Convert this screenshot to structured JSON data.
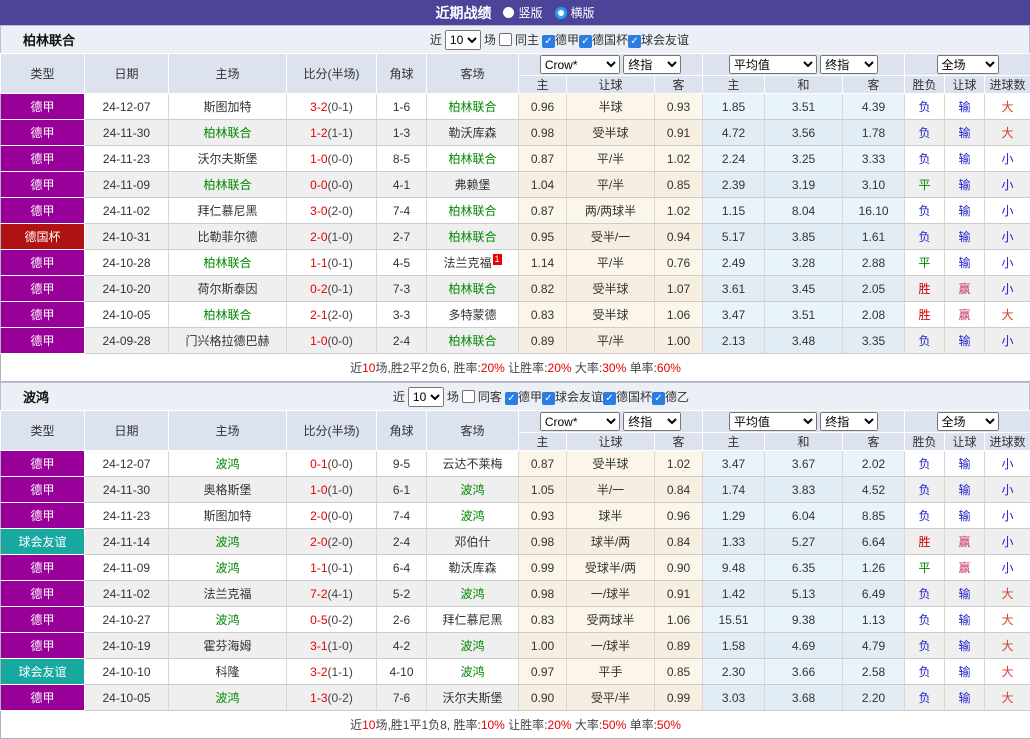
{
  "titlebar": {
    "title": "近期战绩",
    "vertical_label": "竖版",
    "horizontal_label": "横版"
  },
  "table_header": {
    "cols": [
      "类型",
      "日期",
      "主场",
      "比分(半场)",
      "角球",
      "客场"
    ],
    "sub_handicap": [
      "主",
      "让球",
      "客"
    ],
    "sub_europe": [
      "主",
      "和",
      "客"
    ],
    "sub_result": [
      "胜负",
      "让球",
      "进球数"
    ]
  },
  "dropdowns": {
    "count": "10",
    "bookmaker": "Crow*",
    "final1": "终指",
    "average": "平均值",
    "final2": "终指",
    "fullmatch": "全场"
  },
  "type_colors": {
    "德甲": "#990099",
    "德国杯": "#b01111",
    "球会友谊": "#17a8a0"
  },
  "result_colors": {
    "胜": "#d10000",
    "平": "#008800",
    "负": "#2222cc",
    "赢": "#cc3366",
    "输": "#2222cc",
    "大": "#d43f2f",
    "小": "#2222cc"
  },
  "sections": [
    {
      "team": "柏林联合",
      "filters": {
        "recent": "近",
        "count": "10",
        "games": "场",
        "same": "同主",
        "leagues": [
          {
            "label": "德甲",
            "checked": true
          },
          {
            "label": "德国杯",
            "checked": true
          },
          {
            "label": "球会友谊",
            "checked": true
          }
        ]
      },
      "rows": [
        {
          "type": "德甲",
          "date": "24-12-07",
          "home": "斯图加特",
          "score": "3-2",
          "half": "(0-1)",
          "corner": "1-6",
          "away": "柏林联合",
          "h1": "0.96",
          "hc": "半球",
          "h2": "0.93",
          "e1": "1.85",
          "e2": "3.51",
          "e3": "4.39",
          "r": [
            "负",
            "输",
            "大"
          ]
        },
        {
          "type": "德甲",
          "date": "24-11-30",
          "home": "柏林联合",
          "score": "1-2",
          "half": "(1-1)",
          "corner": "1-3",
          "away": "勒沃库森",
          "h1": "0.98",
          "hc": "受半球",
          "h2": "0.91",
          "e1": "4.72",
          "e2": "3.56",
          "e3": "1.78",
          "r": [
            "负",
            "输",
            "大"
          ]
        },
        {
          "type": "德甲",
          "date": "24-11-23",
          "home": "沃尔夫斯堡",
          "score": "1-0",
          "half": "(0-0)",
          "corner": "8-5",
          "away": "柏林联合",
          "h1": "0.87",
          "hc": "平/半",
          "h2": "1.02",
          "e1": "2.24",
          "e2": "3.25",
          "e3": "3.33",
          "r": [
            "负",
            "输",
            "小"
          ]
        },
        {
          "type": "德甲",
          "date": "24-11-09",
          "home": "柏林联合",
          "score": "0-0",
          "half": "(0-0)",
          "corner": "4-1",
          "away": "弗赖堡",
          "h1": "1.04",
          "hc": "平/半",
          "h2": "0.85",
          "e1": "2.39",
          "e2": "3.19",
          "e3": "3.10",
          "r": [
            "平",
            "输",
            "小"
          ]
        },
        {
          "type": "德甲",
          "date": "24-11-02",
          "home": "拜仁慕尼黑",
          "score": "3-0",
          "half": "(2-0)",
          "corner": "7-4",
          "away": "柏林联合",
          "h1": "0.87",
          "hc": "两/两球半",
          "h2": "1.02",
          "e1": "1.15",
          "e2": "8.04",
          "e3": "16.10",
          "r": [
            "负",
            "输",
            "小"
          ]
        },
        {
          "type": "德国杯",
          "date": "24-10-31",
          "home": "比勒菲尔德",
          "score": "2-0",
          "half": "(1-0)",
          "corner": "2-7",
          "away": "柏林联合",
          "h1": "0.95",
          "hc": "受半/一",
          "h2": "0.94",
          "e1": "5.17",
          "e2": "3.85",
          "e3": "1.61",
          "r": [
            "负",
            "输",
            "小"
          ]
        },
        {
          "type": "德甲",
          "date": "24-10-28",
          "home": "柏林联合",
          "score": "1-1",
          "half": "(0-1)",
          "corner": "4-5",
          "away": "法兰克福",
          "sup": "1",
          "h1": "1.14",
          "hc": "平/半",
          "h2": "0.76",
          "e1": "2.49",
          "e2": "3.28",
          "e3": "2.88",
          "r": [
            "平",
            "输",
            "小"
          ]
        },
        {
          "type": "德甲",
          "date": "24-10-20",
          "home": "荷尔斯泰因",
          "score": "0-2",
          "half": "(0-1)",
          "corner": "7-3",
          "away": "柏林联合",
          "h1": "0.82",
          "hc": "受半球",
          "h2": "1.07",
          "e1": "3.61",
          "e2": "3.45",
          "e3": "2.05",
          "r": [
            "胜",
            "赢",
            "小"
          ]
        },
        {
          "type": "德甲",
          "date": "24-10-05",
          "home": "柏林联合",
          "score": "2-1",
          "half": "(2-0)",
          "corner": "3-3",
          "away": "多特蒙德",
          "h1": "0.83",
          "hc": "受半球",
          "h2": "1.06",
          "e1": "3.47",
          "e2": "3.51",
          "e3": "2.08",
          "r": [
            "胜",
            "赢",
            "大"
          ]
        },
        {
          "type": "德甲",
          "date": "24-09-28",
          "home": "门兴格拉德巴赫",
          "score": "1-0",
          "half": "(0-0)",
          "corner": "2-4",
          "away": "柏林联合",
          "h1": "0.89",
          "hc": "平/半",
          "h2": "1.00",
          "e1": "2.13",
          "e2": "3.48",
          "e3": "3.35",
          "r": [
            "负",
            "输",
            "小"
          ]
        }
      ],
      "summary": [
        {
          "t": "近"
        },
        {
          "t": "10",
          "red": true
        },
        {
          "t": "场,胜2平2负6, 胜率:"
        },
        {
          "t": "20%",
          "red": true
        },
        {
          "t": " 让胜率:"
        },
        {
          "t": "20%",
          "red": true
        },
        {
          "t": " 大率:"
        },
        {
          "t": "30%",
          "red": true
        },
        {
          "t": " 单率:"
        },
        {
          "t": "60%",
          "red": true
        }
      ]
    },
    {
      "team": "波鸿",
      "filters": {
        "recent": "近",
        "count": "10",
        "games": "场",
        "same": "同客",
        "leagues": [
          {
            "label": "德甲",
            "checked": true
          },
          {
            "label": "球会友谊",
            "checked": true
          },
          {
            "label": "德国杯",
            "checked": true
          },
          {
            "label": "德乙",
            "checked": true
          }
        ]
      },
      "rows": [
        {
          "type": "德甲",
          "date": "24-12-07",
          "home": "波鸿",
          "score": "0-1",
          "half": "(0-0)",
          "corner": "9-5",
          "away": "云达不莱梅",
          "h1": "0.87",
          "hc": "受半球",
          "h2": "1.02",
          "e1": "3.47",
          "e2": "3.67",
          "e3": "2.02",
          "r": [
            "负",
            "输",
            "小"
          ]
        },
        {
          "type": "德甲",
          "date": "24-11-30",
          "home": "奥格斯堡",
          "score": "1-0",
          "half": "(1-0)",
          "corner": "6-1",
          "away": "波鸿",
          "h1": "1.05",
          "hc": "半/一",
          "h2": "0.84",
          "e1": "1.74",
          "e2": "3.83",
          "e3": "4.52",
          "r": [
            "负",
            "输",
            "小"
          ]
        },
        {
          "type": "德甲",
          "date": "24-11-23",
          "home": "斯图加特",
          "score": "2-0",
          "half": "(0-0)",
          "corner": "7-4",
          "away": "波鸿",
          "h1": "0.93",
          "hc": "球半",
          "h2": "0.96",
          "e1": "1.29",
          "e2": "6.04",
          "e3": "8.85",
          "r": [
            "负",
            "输",
            "小"
          ]
        },
        {
          "type": "球会友谊",
          "date": "24-11-14",
          "home": "波鸿",
          "score": "2-0",
          "half": "(2-0)",
          "corner": "2-4",
          "away": "邓伯什",
          "h1": "0.98",
          "hc": "球半/两",
          "h2": "0.84",
          "e1": "1.33",
          "e2": "5.27",
          "e3": "6.64",
          "r": [
            "胜",
            "赢",
            "小"
          ]
        },
        {
          "type": "德甲",
          "date": "24-11-09",
          "home": "波鸿",
          "score": "1-1",
          "half": "(0-1)",
          "corner": "6-4",
          "away": "勒沃库森",
          "h1": "0.99",
          "hc": "受球半/两",
          "h2": "0.90",
          "e1": "9.48",
          "e2": "6.35",
          "e3": "1.26",
          "r": [
            "平",
            "赢",
            "小"
          ]
        },
        {
          "type": "德甲",
          "date": "24-11-02",
          "home": "法兰克福",
          "score": "7-2",
          "half": "(4-1)",
          "corner": "5-2",
          "away": "波鸿",
          "h1": "0.98",
          "hc": "一/球半",
          "h2": "0.91",
          "e1": "1.42",
          "e2": "5.13",
          "e3": "6.49",
          "r": [
            "负",
            "输",
            "大"
          ]
        },
        {
          "type": "德甲",
          "date": "24-10-27",
          "home": "波鸿",
          "score": "0-5",
          "half": "(0-2)",
          "corner": "2-6",
          "away": "拜仁慕尼黑",
          "h1": "0.83",
          "hc": "受两球半",
          "h2": "1.06",
          "e1": "15.51",
          "e2": "9.38",
          "e3": "1.13",
          "r": [
            "负",
            "输",
            "大"
          ]
        },
        {
          "type": "德甲",
          "date": "24-10-19",
          "home": "霍芬海姆",
          "score": "3-1",
          "half": "(1-0)",
          "corner": "4-2",
          "away": "波鸿",
          "h1": "1.00",
          "hc": "一/球半",
          "h2": "0.89",
          "e1": "1.58",
          "e2": "4.69",
          "e3": "4.79",
          "r": [
            "负",
            "输",
            "大"
          ]
        },
        {
          "type": "球会友谊",
          "date": "24-10-10",
          "home": "科隆",
          "score": "3-2",
          "half": "(1-1)",
          "corner": "4-10",
          "away": "波鸿",
          "h1": "0.97",
          "hc": "平手",
          "h2": "0.85",
          "e1": "2.30",
          "e2": "3.66",
          "e3": "2.58",
          "r": [
            "负",
            "输",
            "大"
          ]
        },
        {
          "type": "德甲",
          "date": "24-10-05",
          "home": "波鸿",
          "score": "1-3",
          "half": "(0-2)",
          "corner": "7-6",
          "away": "沃尔夫斯堡",
          "h1": "0.90",
          "hc": "受平/半",
          "h2": "0.99",
          "e1": "3.03",
          "e2": "3.68",
          "e3": "2.20",
          "r": [
            "负",
            "输",
            "大"
          ]
        }
      ],
      "summary": [
        {
          "t": "近"
        },
        {
          "t": "10",
          "red": true
        },
        {
          "t": "场,胜1平1负8, 胜率:"
        },
        {
          "t": "10%",
          "red": true
        },
        {
          "t": " 让胜率:"
        },
        {
          "t": "20%",
          "red": true
        },
        {
          "t": " 大率:"
        },
        {
          "t": "50%",
          "red": true
        },
        {
          "t": " 单率:"
        },
        {
          "t": "50%",
          "red": true
        }
      ]
    }
  ]
}
